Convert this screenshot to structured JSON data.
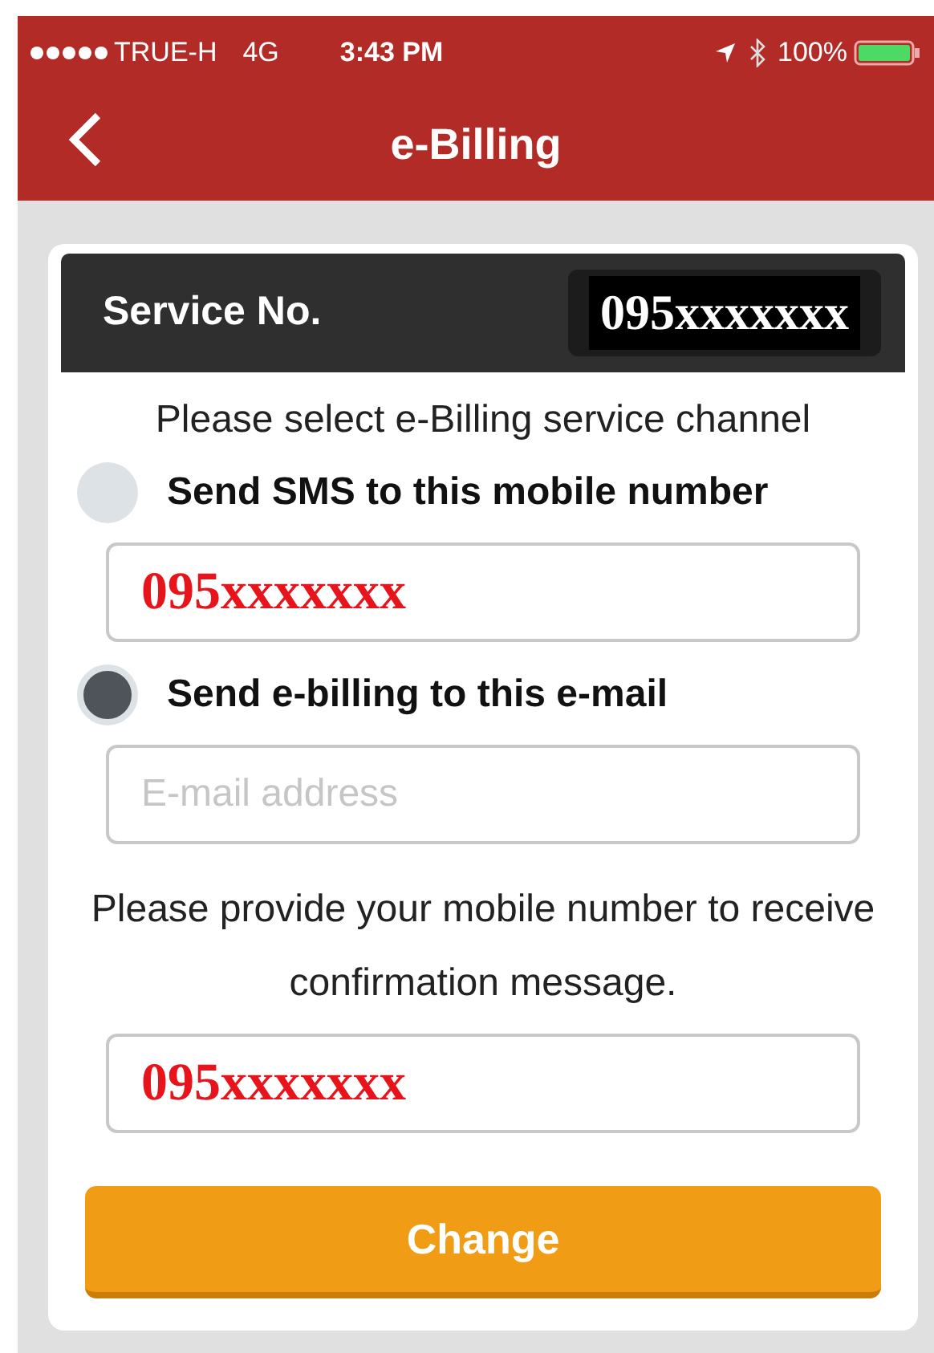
{
  "status_bar": {
    "carrier": "TRUE-H",
    "network": "4G",
    "time": "3:43 PM",
    "battery": "100%"
  },
  "nav_bar": {
    "title": "e-Billing"
  },
  "service": {
    "label": "Service No.",
    "value": "095xxxxxxx"
  },
  "instruction": "Please select e-Billing service channel",
  "channels": [
    {
      "label": "Send SMS to this mobile number",
      "selected": false,
      "field": {
        "value": "095xxxxxxx"
      }
    },
    {
      "label": "Send e-billing to this e-mail",
      "selected": true,
      "field": {
        "placeholder": "E-mail address"
      }
    }
  ],
  "confirmation": {
    "text": "Please provide your mobile number to receive confirmation message.",
    "field": {
      "value": "095xxxxxxx"
    }
  },
  "button": "Change"
}
